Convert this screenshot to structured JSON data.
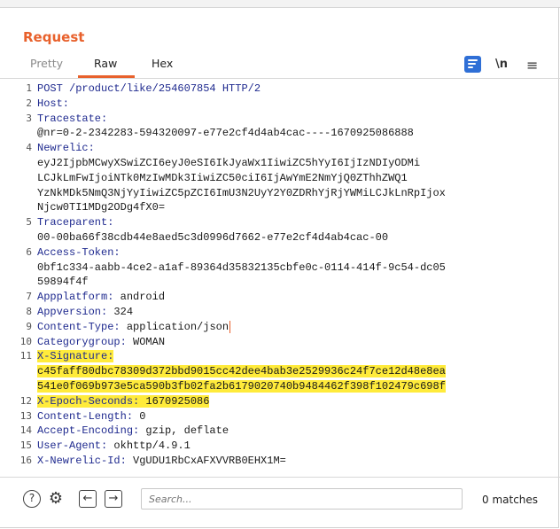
{
  "panel": {
    "title": "Request"
  },
  "tabs": [
    {
      "label": "Pretty"
    },
    {
      "label": "Raw"
    },
    {
      "label": "Hex"
    }
  ],
  "toolbar": {
    "newline_label": "\\n",
    "menu_label": "≡"
  },
  "editor": {
    "lines": [
      {
        "n": "1",
        "key": "POST /product/like/254607854 HTTP/2",
        "value": ""
      },
      {
        "n": "2",
        "key": "Host:",
        "value": ""
      },
      {
        "n": "3",
        "key": "Tracestate:",
        "value": ""
      },
      {
        "n": "",
        "key": "",
        "value": "@nr=0-2-2342283-594320097-e77e2cf4d4ab4cac----1670925086888"
      },
      {
        "n": "4",
        "key": "Newrelic:",
        "value": ""
      },
      {
        "n": "",
        "key": "",
        "value": "eyJ2IjpbMCwyXSwiZCI6eyJ0eSI6IkJyaWx1IiwiZC5hYyI6IjIzNDIyODMi"
      },
      {
        "n": "",
        "key": "",
        "value": "LCJkLmFwIjoiNTk0MzIwMDk3IiwiZC50ciI6IjAwYmE2NmYjQ0ZThhZWQ1"
      },
      {
        "n": "",
        "key": "",
        "value": "YzNkMDk5NmQ3NjYyIiwiZC5pZCI6ImU3N2UyY2Y0ZDRhYjRjYWMiLCJkLnRpIjox"
      },
      {
        "n": "",
        "key": "",
        "value": "Njcw0TI1MDg2ODg4fX0="
      },
      {
        "n": "5",
        "key": "Traceparent:",
        "value": ""
      },
      {
        "n": "",
        "key": "",
        "value": "00-00ba66f38cdb44e8aed5c3d0996d7662-e77e2cf4d4ab4cac-00"
      },
      {
        "n": "6",
        "key": "Access-Token:",
        "value": ""
      },
      {
        "n": "",
        "key": "",
        "value": "0bf1c334-aabb-4ce2-a1af-89364d35832135cbfe0c-0114-414f-9c54-dc05"
      },
      {
        "n": "",
        "key": "",
        "value": "59894f4f"
      },
      {
        "n": "7",
        "key": "Appplatform:",
        "value": " android"
      },
      {
        "n": "8",
        "key": "Appversion:",
        "value": " 324"
      },
      {
        "n": "9",
        "key": "Content-Type:",
        "value": " application/json"
      },
      {
        "n": "10",
        "key": "Categorygroup:",
        "value": " WOMAN"
      },
      {
        "n": "11",
        "key": "X-Signature:",
        "value": "",
        "highlight": true
      },
      {
        "n": "",
        "key": "",
        "value": "c45faff80dbc78309d372bbd9015cc42dee4bab3e2529936c24f7ce12d48e8ea",
        "highlight": true
      },
      {
        "n": "",
        "key": "",
        "value": "541e0f069b973e5ca590b3fb02fa2b6179020740b9484462f398f102479c698f",
        "highlight": true
      },
      {
        "n": "12",
        "key": "X-Epoch-Seconds:",
        "value": " 1670925086",
        "highlight": true
      },
      {
        "n": "13",
        "key": "Content-Length:",
        "value": " 0"
      },
      {
        "n": "14",
        "key": "Accept-Encoding:",
        "value": " gzip, deflate"
      },
      {
        "n": "15",
        "key": "User-Agent:",
        "value": " okhttp/4.9.1"
      },
      {
        "n": "16",
        "key": "X-Newrelic-Id:",
        "value": " VgUDU1RbCxAFXVVRB0EHX1M="
      }
    ]
  },
  "search": {
    "placeholder": "Search..."
  },
  "status": {
    "matches": "0 matches"
  }
}
